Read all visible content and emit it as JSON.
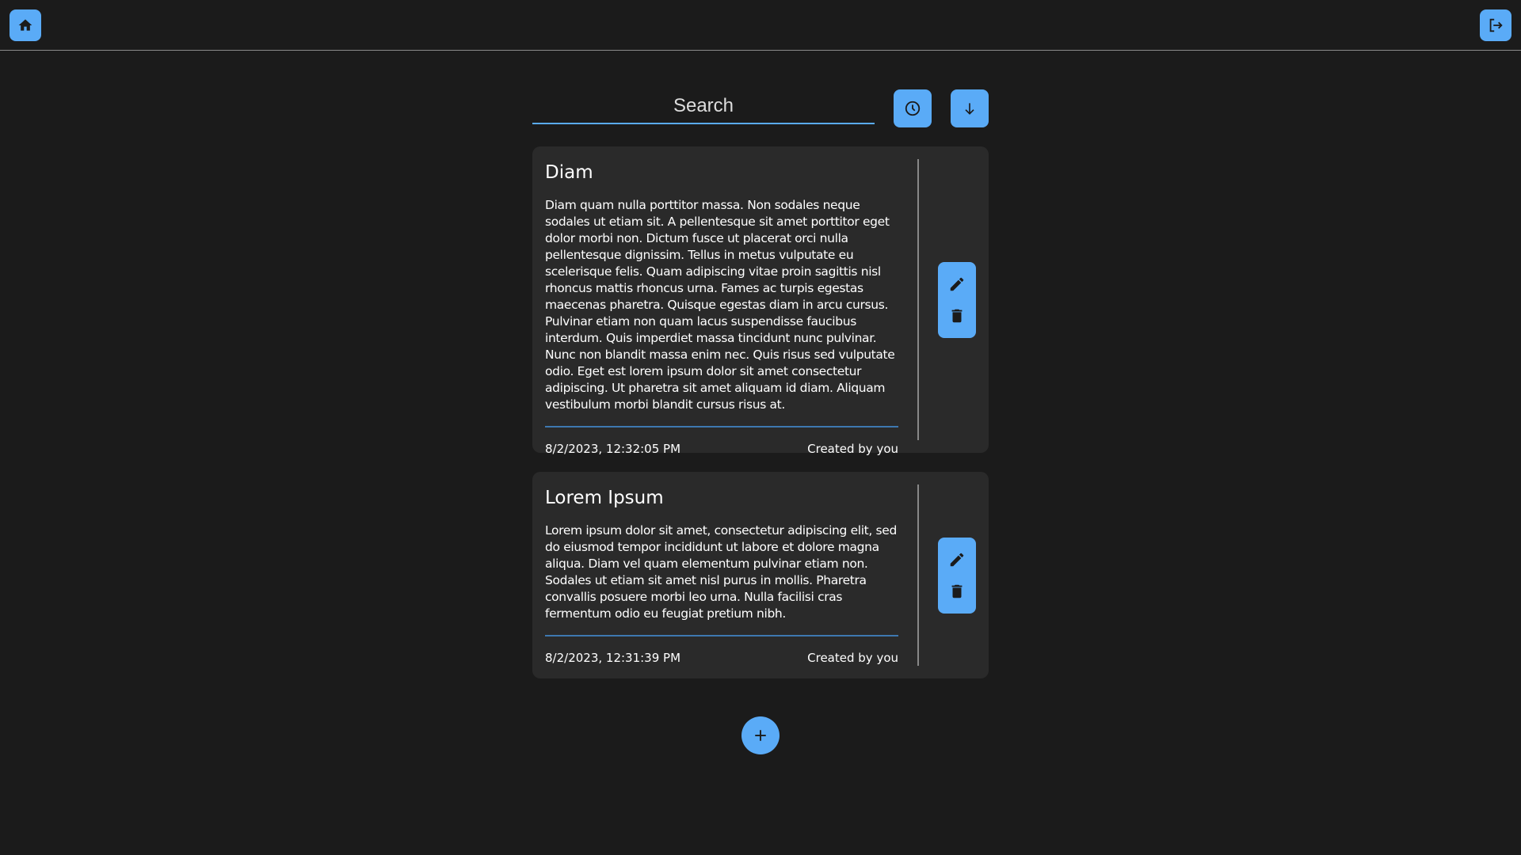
{
  "search": {
    "placeholder": "Search"
  },
  "colors": {
    "accent": "#5aabf7",
    "background": "#1b1b1b",
    "card": "#2a2a2a"
  },
  "notes": [
    {
      "title": "Diam",
      "body": "Diam quam nulla porttitor massa. Non sodales neque sodales ut etiam sit. A pellentesque sit amet porttitor eget dolor morbi non. Dictum fusce ut placerat orci nulla pellentesque dignissim. Tellus in metus vulputate eu scelerisque felis. Quam adipiscing vitae proin sagittis nisl rhoncus mattis rhoncus urna. Fames ac turpis egestas maecenas pharetra. Quisque egestas diam in arcu cursus. Pulvinar etiam non quam lacus suspendisse faucibus interdum. Quis imperdiet massa tincidunt nunc pulvinar. Nunc non blandit massa enim nec. Quis risus sed vulputate odio. Eget est lorem ipsum dolor sit amet consectetur adipiscing. Ut pharetra sit amet aliquam id diam. Aliquam vestibulum morbi blandit cursus risus at.",
      "date": "8/2/2023, 12:32:05 PM",
      "author": "Created by you"
    },
    {
      "title": "Lorem Ipsum",
      "body": "Lorem ipsum dolor sit amet, consectetur adipiscing elit, sed do eiusmod tempor incididunt ut labore et dolore magna aliqua. Diam vel quam elementum pulvinar etiam non. Sodales ut etiam sit amet nisl purus in mollis. Pharetra convallis posuere morbi leo urna. Nulla facilisi cras fermentum odio eu feugiat pretium nibh.",
      "date": "8/2/2023, 12:31:39 PM",
      "author": "Created by you"
    }
  ]
}
